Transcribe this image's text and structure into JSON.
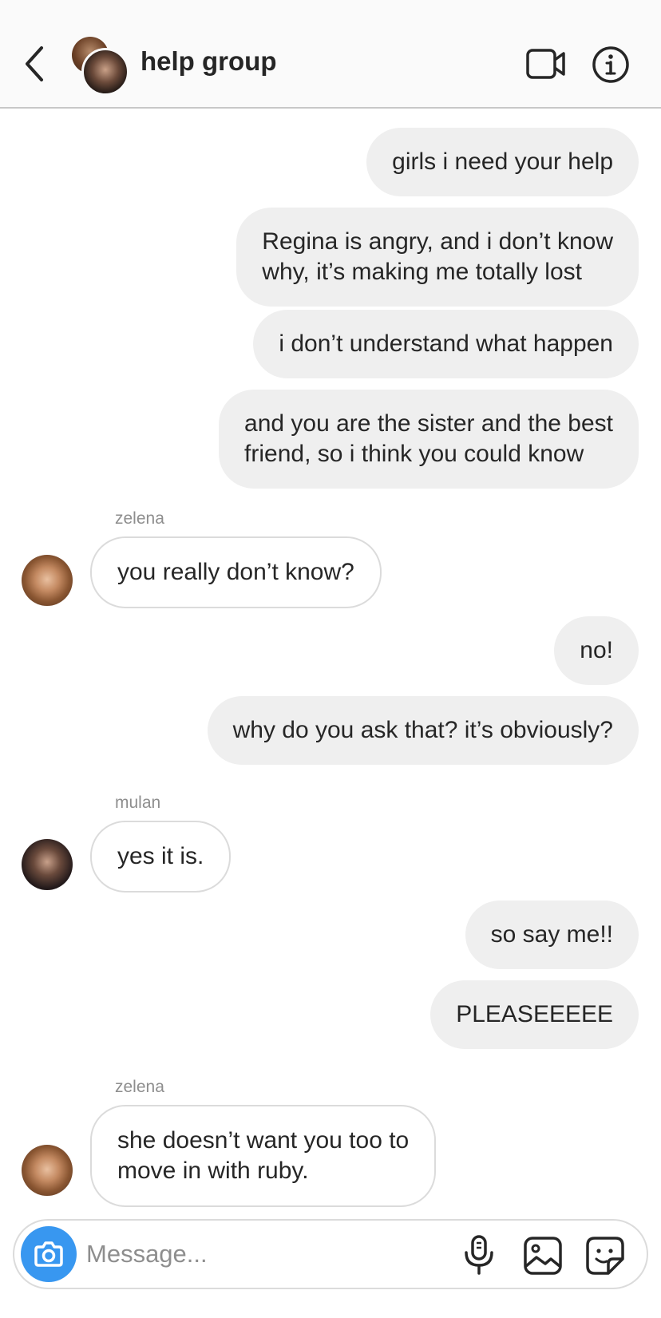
{
  "header": {
    "title": "help group",
    "back_icon": "chevron-left-icon",
    "video_icon": "video-camera-icon",
    "info_icon": "info-icon"
  },
  "messages": [
    {
      "direction": "outgoing",
      "text": "girls i need your help"
    },
    {
      "direction": "outgoing",
      "lines": [
        "Regina is angry, and i don’t know",
        "why, it’s making me totally lost"
      ]
    },
    {
      "direction": "outgoing",
      "text": "i don’t understand what happen"
    },
    {
      "direction": "outgoing",
      "lines": [
        "and you are the sister and the best",
        "friend, so i think you could know"
      ]
    },
    {
      "direction": "incoming",
      "sender": "zelena",
      "text": "you really don’t know?"
    },
    {
      "direction": "outgoing",
      "text": "no!"
    },
    {
      "direction": "outgoing",
      "text": "why do you ask that? it’s obviously?"
    },
    {
      "direction": "incoming",
      "sender": "mulan",
      "text": "yes it is."
    },
    {
      "direction": "outgoing",
      "text": "so say me!!"
    },
    {
      "direction": "outgoing",
      "text": "PLEASEEEEE"
    },
    {
      "direction": "incoming",
      "sender": "zelena",
      "lines": [
        "she doesn’t want you too to",
        "move in with ruby."
      ]
    }
  ],
  "composer": {
    "placeholder": "Message...",
    "value": "",
    "camera_icon": "camera-icon",
    "mic_icon": "microphone-icon",
    "gallery_icon": "gallery-icon",
    "sticker_icon": "sticker-icon"
  },
  "colors": {
    "outgoing_bubble": "#efefef",
    "incoming_border": "#dbdbdb",
    "camera_button": "#3897f0",
    "sender_label": "#8e8e8e"
  }
}
